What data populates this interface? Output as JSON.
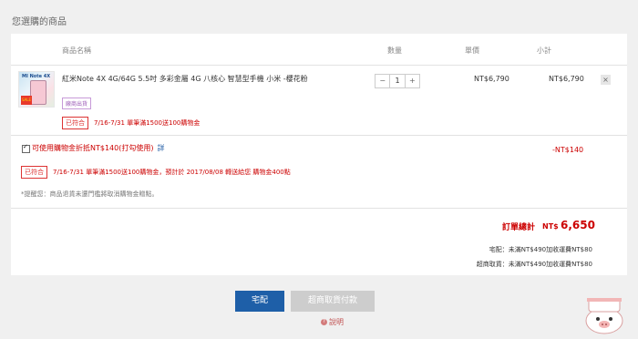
{
  "section_title": "您選購的商品",
  "table": {
    "headers": {
      "name": "商品名稱",
      "qty": "數量",
      "price": "單價",
      "subtotal": "小計"
    }
  },
  "product": {
    "thumb_brand": "MI Note 4X",
    "thumb_badge": "SALE",
    "name": "紅米Note 4X 4G/64G 5.5吋 多彩金屬 4G 八核心 智慧型手機 小米 -櫻花粉",
    "tag_purple": "廠商出貨",
    "tag_red": "已符合",
    "promo": "7/16-7/31 單筆滿1500送100購物金",
    "qty_minus": "−",
    "qty_value": "1",
    "qty_plus": "+",
    "unit_price": "NT$6,790",
    "subtotal": "NT$6,790",
    "remove": "×"
  },
  "credit": {
    "text": "可使用購物金折抵NT$140(打勾使用)",
    "link": "詳",
    "discount": "-NT$140"
  },
  "promo2": {
    "tag": "已符合",
    "text": "7/16-7/31 單筆滿1500送100購物金，預計於 2017/08/08 轉送給您 購物金400點"
  },
  "note": "*提醒您：商品退貨未還門檻將取消購物金贈點。",
  "summary": {
    "total_label": "訂單總計",
    "total_currency": "NT$",
    "total_value": "6,650",
    "home_delivery": "宅配：未滿NT$490加收運費NT$80",
    "store_pickup": "超商取貨：未滿NT$490加收運費NT$80"
  },
  "actions": {
    "home_delivery_button": "宅配",
    "store_pickup_button": "超商取貨付款",
    "help_icon": "?",
    "help": "說明"
  }
}
